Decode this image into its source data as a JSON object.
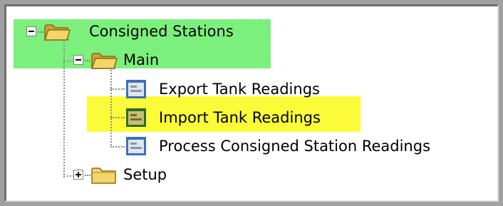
{
  "tree": {
    "root": {
      "label": "Consigned Stations",
      "icon": "folder-open-icon",
      "expanded": true
    },
    "main": {
      "label": "Main",
      "icon": "folder-open-icon",
      "expanded": true
    },
    "items": [
      {
        "label": "Export Tank Readings",
        "icon": "form-icon",
        "highlighted": false
      },
      {
        "label": "Import Tank Readings",
        "icon": "form-icon",
        "highlighted": true
      },
      {
        "label": "Process Consigned Station Readings",
        "icon": "form-icon",
        "highlighted": false
      }
    ],
    "setup": {
      "label": "Setup",
      "icon": "folder-closed-icon",
      "expanded": false
    }
  },
  "colors": {
    "highlight_green": "#7cf07c",
    "highlight_yellow": "#fbfb3a",
    "folder_yellow": "#f3d66a",
    "form_blue": "#3d6fb8",
    "form_green": "#2e6b2e"
  }
}
